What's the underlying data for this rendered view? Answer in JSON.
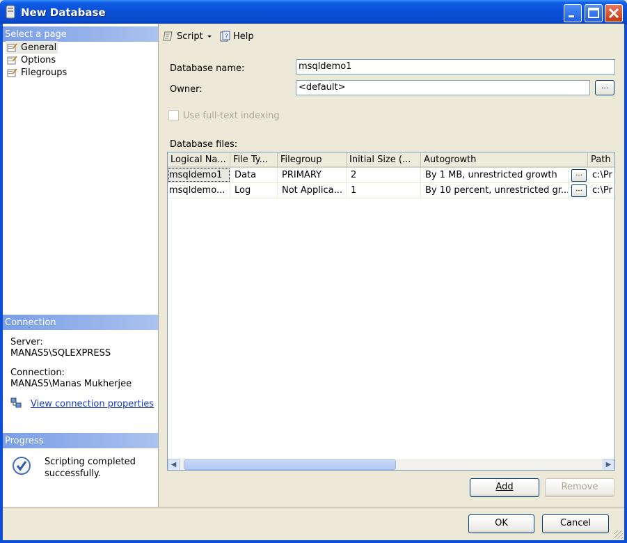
{
  "window": {
    "title": "New Database"
  },
  "left_pane": {
    "select_page_header": "Select a page",
    "pages": [
      {
        "label": "General",
        "icon": "page-wrench-icon",
        "selected": true
      },
      {
        "label": "Options",
        "icon": "page-wrench-icon",
        "selected": false
      },
      {
        "label": "Filegroups",
        "icon": "page-wrench-icon",
        "selected": false
      }
    ],
    "connection_header": "Connection",
    "server_label": "Server:",
    "server_value": "MANAS5\\SQLEXPRESS",
    "connection_label": "Connection:",
    "connection_value": "MANAS5\\Manas Mukherjee",
    "view_connection_link": "View connection properties",
    "progress_header": "Progress",
    "progress_text": "Scripting completed successfully."
  },
  "toolbar": {
    "script_label": "Script",
    "help_label": "Help"
  },
  "form": {
    "db_name_label": "Database name:",
    "db_name_value": "msqldemo1",
    "owner_label": "Owner:",
    "owner_value": "<default>",
    "browse_label": "...",
    "fulltext_label": "Use full-text indexing",
    "db_files_label": "Database files:"
  },
  "grid": {
    "columns": [
      "Logical Na...",
      "File Ty...",
      "Filegroup",
      "Initial Size (...",
      "Autogrowth",
      "Path"
    ],
    "rows": [
      [
        "msqldemo1",
        "Data",
        "PRIMARY",
        "2",
        "By 1 MB, unrestricted growth",
        "c:\\Pr"
      ],
      [
        "msqldemo...",
        "Log",
        "Not Applica...",
        "1",
        "By 10 percent, unrestricted gr...",
        "c:\\Pr"
      ]
    ],
    "cell_button_label": "..."
  },
  "buttons": {
    "add": "Add",
    "remove": "Remove",
    "ok": "OK",
    "cancel": "Cancel"
  }
}
